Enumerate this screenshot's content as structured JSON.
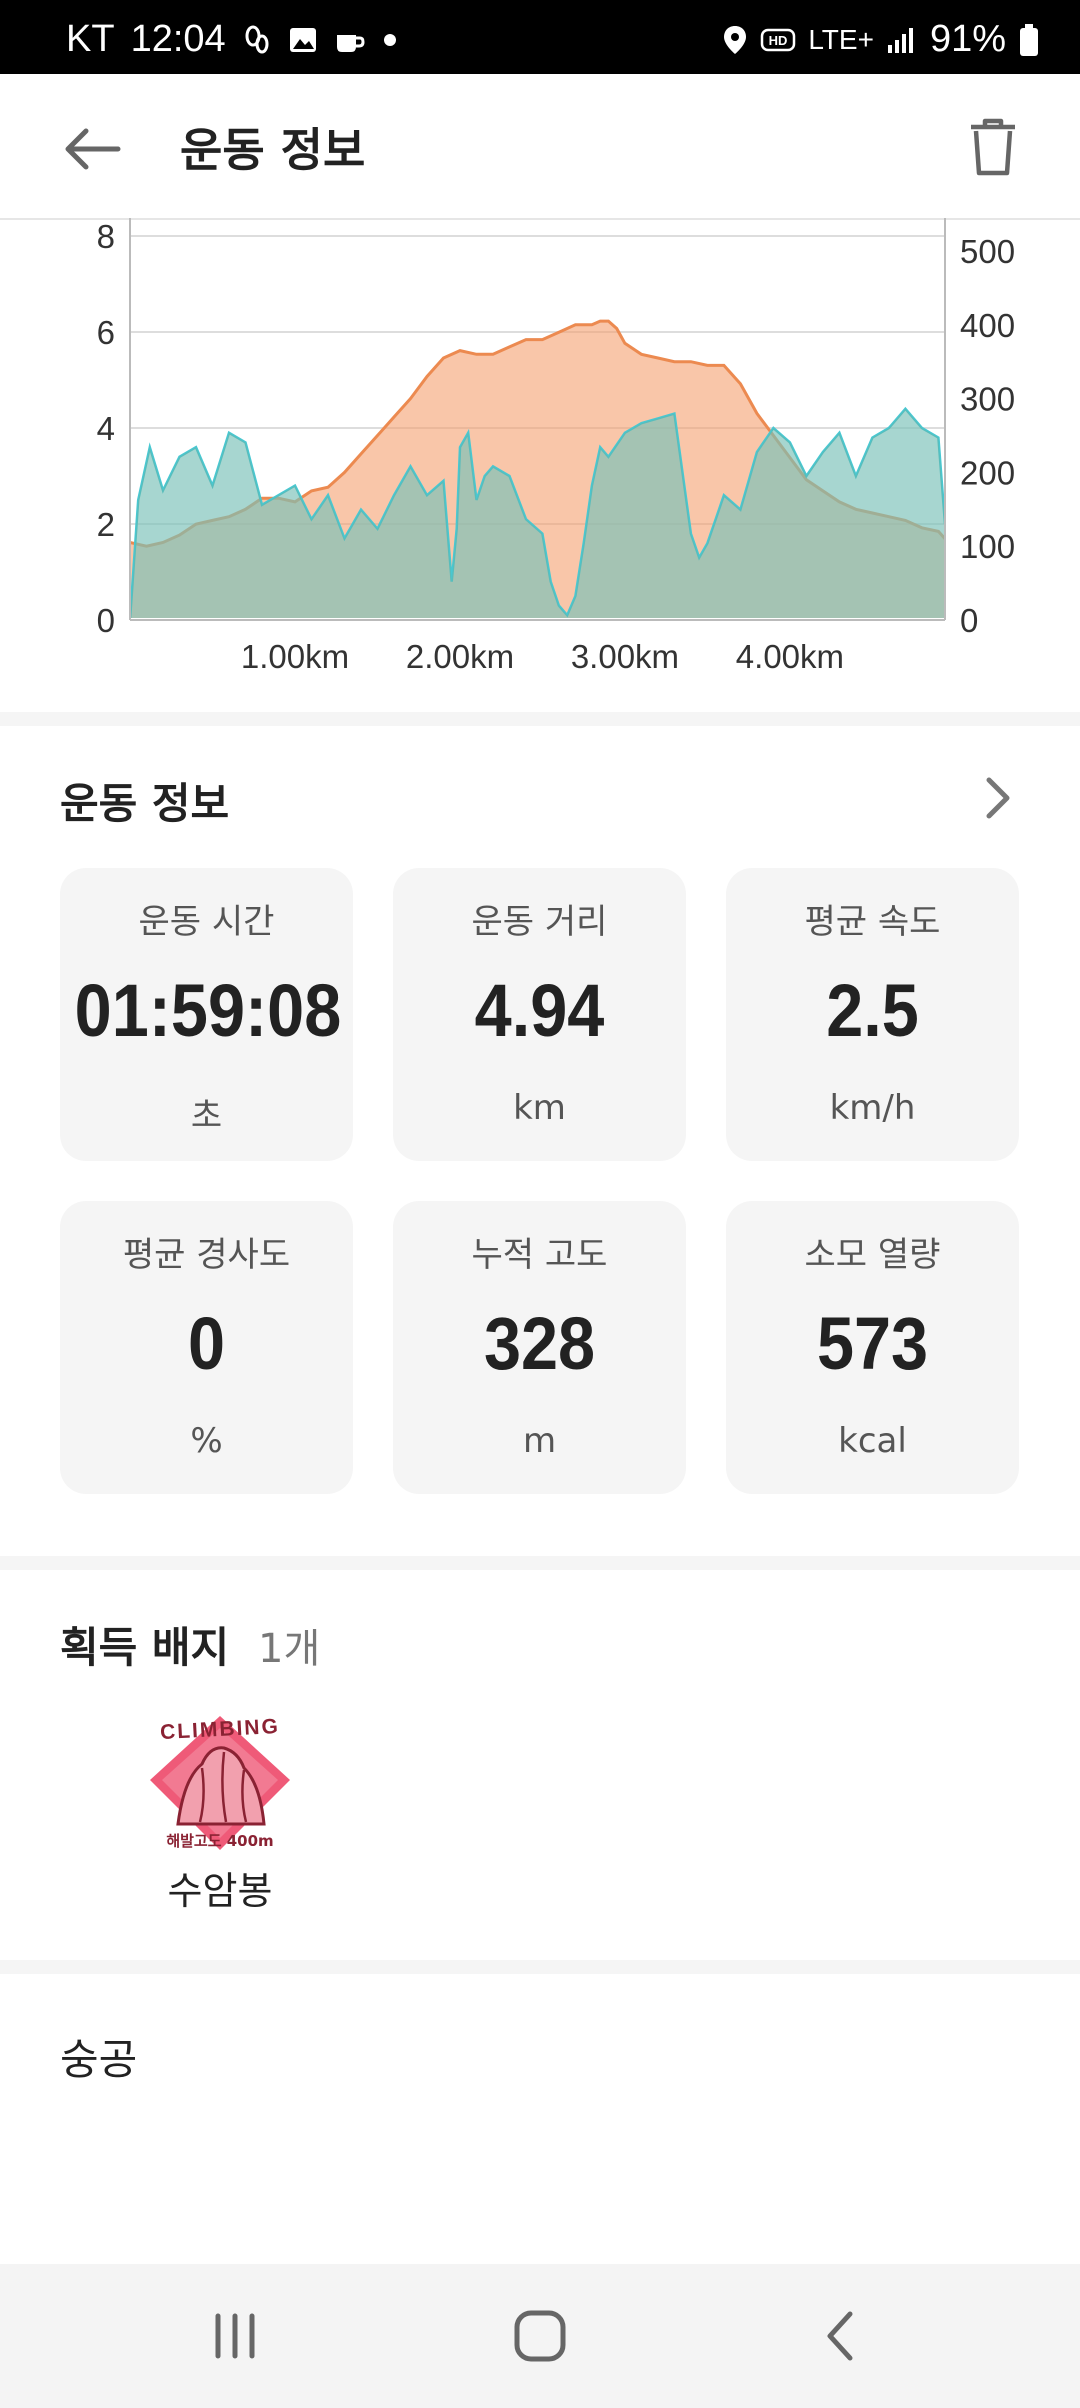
{
  "status_bar": {
    "carrier": "KT",
    "time": "12:04",
    "network": "LTE+",
    "battery": "91%",
    "icons": [
      "footprint-icon",
      "image-icon",
      "coffee-icon",
      "dot-icon",
      "location-icon",
      "hd-icon",
      "signal-icon",
      "battery-icon"
    ]
  },
  "app_bar": {
    "title": "운동 정보",
    "back_icon": "arrow-left-icon",
    "delete_icon": "trash-icon"
  },
  "chart_data": {
    "type": "area",
    "x_ticks": [
      "1.00km",
      "2.00km",
      "3.00km",
      "4.00km"
    ],
    "x_tick_values_km": [
      1,
      2,
      3,
      4
    ],
    "x_range_km": [
      0,
      4.94
    ],
    "y_left_ticks": [
      "0",
      "2",
      "4",
      "6",
      "8"
    ],
    "y_left_range": [
      0,
      8
    ],
    "y_right_ticks": [
      "0",
      "100",
      "200",
      "300",
      "400",
      "500"
    ],
    "y_right_range": [
      0,
      500
    ],
    "grid": true,
    "series": [
      {
        "axis": "left",
        "color": "#6fd9e0",
        "x": [
          0,
          0.05,
          0.12,
          0.2,
          0.3,
          0.4,
          0.5,
          0.6,
          0.7,
          0.8,
          0.9,
          1.0,
          1.1,
          1.2,
          1.3,
          1.4,
          1.5,
          1.6,
          1.7,
          1.8,
          1.9,
          1.95,
          1.98,
          2.0,
          2.05,
          2.1,
          2.15,
          2.2,
          2.3,
          2.4,
          2.5,
          2.55,
          2.6,
          2.65,
          2.7,
          2.75,
          2.8,
          2.85,
          2.9,
          3.0,
          3.1,
          3.2,
          3.3,
          3.4,
          3.45,
          3.5,
          3.55,
          3.6,
          3.7,
          3.8,
          3.9,
          4.0,
          4.1,
          4.2,
          4.3,
          4.4,
          4.5,
          4.6,
          4.7,
          4.8,
          4.9,
          4.94
        ],
        "values": [
          0,
          2.5,
          3.6,
          2.7,
          3.4,
          3.6,
          2.8,
          3.9,
          3.7,
          2.4,
          2.6,
          2.8,
          2.1,
          2.6,
          1.7,
          2.3,
          1.9,
          2.6,
          3.2,
          2.6,
          2.9,
          0.8,
          1.9,
          3.6,
          3.9,
          2.5,
          3.0,
          3.2,
          3.0,
          2.1,
          1.8,
          0.8,
          0.3,
          0.1,
          0.5,
          1.6,
          2.8,
          3.6,
          3.4,
          3.9,
          4.1,
          4.2,
          4.3,
          1.8,
          1.3,
          1.6,
          2.1,
          2.6,
          2.3,
          3.5,
          4.0,
          3.7,
          3.0,
          3.5,
          3.9,
          3.0,
          3.8,
          4.0,
          4.4,
          4.0,
          3.8,
          2.0
        ]
      },
      {
        "axis": "right",
        "color": "#f5a070",
        "x": [
          0,
          0.1,
          0.2,
          0.3,
          0.4,
          0.5,
          0.6,
          0.7,
          0.8,
          0.9,
          1.0,
          1.1,
          1.2,
          1.3,
          1.4,
          1.5,
          1.6,
          1.7,
          1.8,
          1.9,
          2.0,
          2.1,
          2.2,
          2.3,
          2.4,
          2.5,
          2.6,
          2.7,
          2.8,
          2.85,
          2.9,
          2.95,
          3.0,
          3.1,
          3.2,
          3.3,
          3.4,
          3.5,
          3.6,
          3.7,
          3.8,
          3.9,
          4.0,
          4.1,
          4.2,
          4.3,
          4.4,
          4.5,
          4.6,
          4.7,
          4.8,
          4.9,
          4.94
        ],
        "values": [
          105,
          100,
          105,
          115,
          130,
          135,
          140,
          150,
          165,
          165,
          160,
          175,
          180,
          200,
          225,
          250,
          275,
          300,
          330,
          355,
          365,
          360,
          360,
          370,
          380,
          380,
          390,
          400,
          400,
          405,
          405,
          395,
          375,
          360,
          355,
          350,
          350,
          345,
          345,
          320,
          280,
          250,
          220,
          190,
          175,
          160,
          150,
          145,
          140,
          135,
          125,
          120,
          110
        ]
      }
    ]
  },
  "summary": {
    "title": "운동 정보",
    "chevron_icon": "chevron-right-icon",
    "stats": [
      {
        "label": "운동 시간",
        "value": "01:59:08",
        "unit": "초"
      },
      {
        "label": "운동 거리",
        "value": "4.94",
        "unit": "km"
      },
      {
        "label": "평균 속도",
        "value": "2.5",
        "unit": "km/h"
      },
      {
        "label": "평균 경사도",
        "value": "0",
        "unit": "%"
      },
      {
        "label": "누적 고도",
        "value": "328",
        "unit": "m"
      },
      {
        "label": "소모 열량",
        "value": "573",
        "unit": "kcal"
      }
    ]
  },
  "badges": {
    "title": "획득 배지",
    "count": "1개",
    "items": [
      {
        "name": "수암봉",
        "icon": "climbing-badge-icon",
        "badge_top_text": "CLIMBING",
        "badge_bottom_text": "해발고도 400m"
      }
    ]
  },
  "memo": {
    "text": "숭공"
  },
  "nav_bar": {
    "icons": [
      "recent-apps-icon",
      "home-icon",
      "back-icon"
    ]
  },
  "colors": {
    "accent_orange": "#f5a070",
    "speed_cyan": "#6fd9e0",
    "card_bg": "#f5f5f5"
  }
}
